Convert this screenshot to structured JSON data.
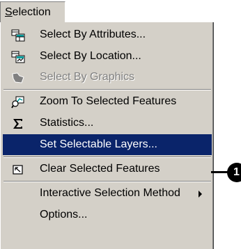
{
  "menu": {
    "title_mnemonic": "S",
    "title_rest": "election"
  },
  "items": [
    {
      "label": "Select By Attributes...",
      "icon": "select-by-attributes-icon",
      "enabled": true
    },
    {
      "label": "Select By Location...",
      "icon": "select-by-location-icon",
      "enabled": true
    },
    {
      "label": "Select By Graphics",
      "icon": "select-by-graphics-icon",
      "enabled": false
    },
    {
      "label": "Zoom To Selected Features",
      "icon": "zoom-to-selected-icon",
      "enabled": true
    },
    {
      "label": "Statistics...",
      "icon": "sigma-icon",
      "enabled": true
    },
    {
      "label": "Set Selectable Layers...",
      "icon": "",
      "enabled": true,
      "highlighted": true
    },
    {
      "label": "Clear Selected Features",
      "icon": "clear-selection-icon",
      "enabled": true
    },
    {
      "label": "Interactive Selection Method",
      "icon": "",
      "enabled": true,
      "submenu": true
    },
    {
      "label": "Options...",
      "icon": "",
      "enabled": true
    }
  ],
  "callout": {
    "number": "1"
  },
  "colors": {
    "menu_bg": "#d4d0c8",
    "highlight_bg": "#0a246a",
    "highlight_text": "#ffffff",
    "disabled_text": "#808080"
  }
}
